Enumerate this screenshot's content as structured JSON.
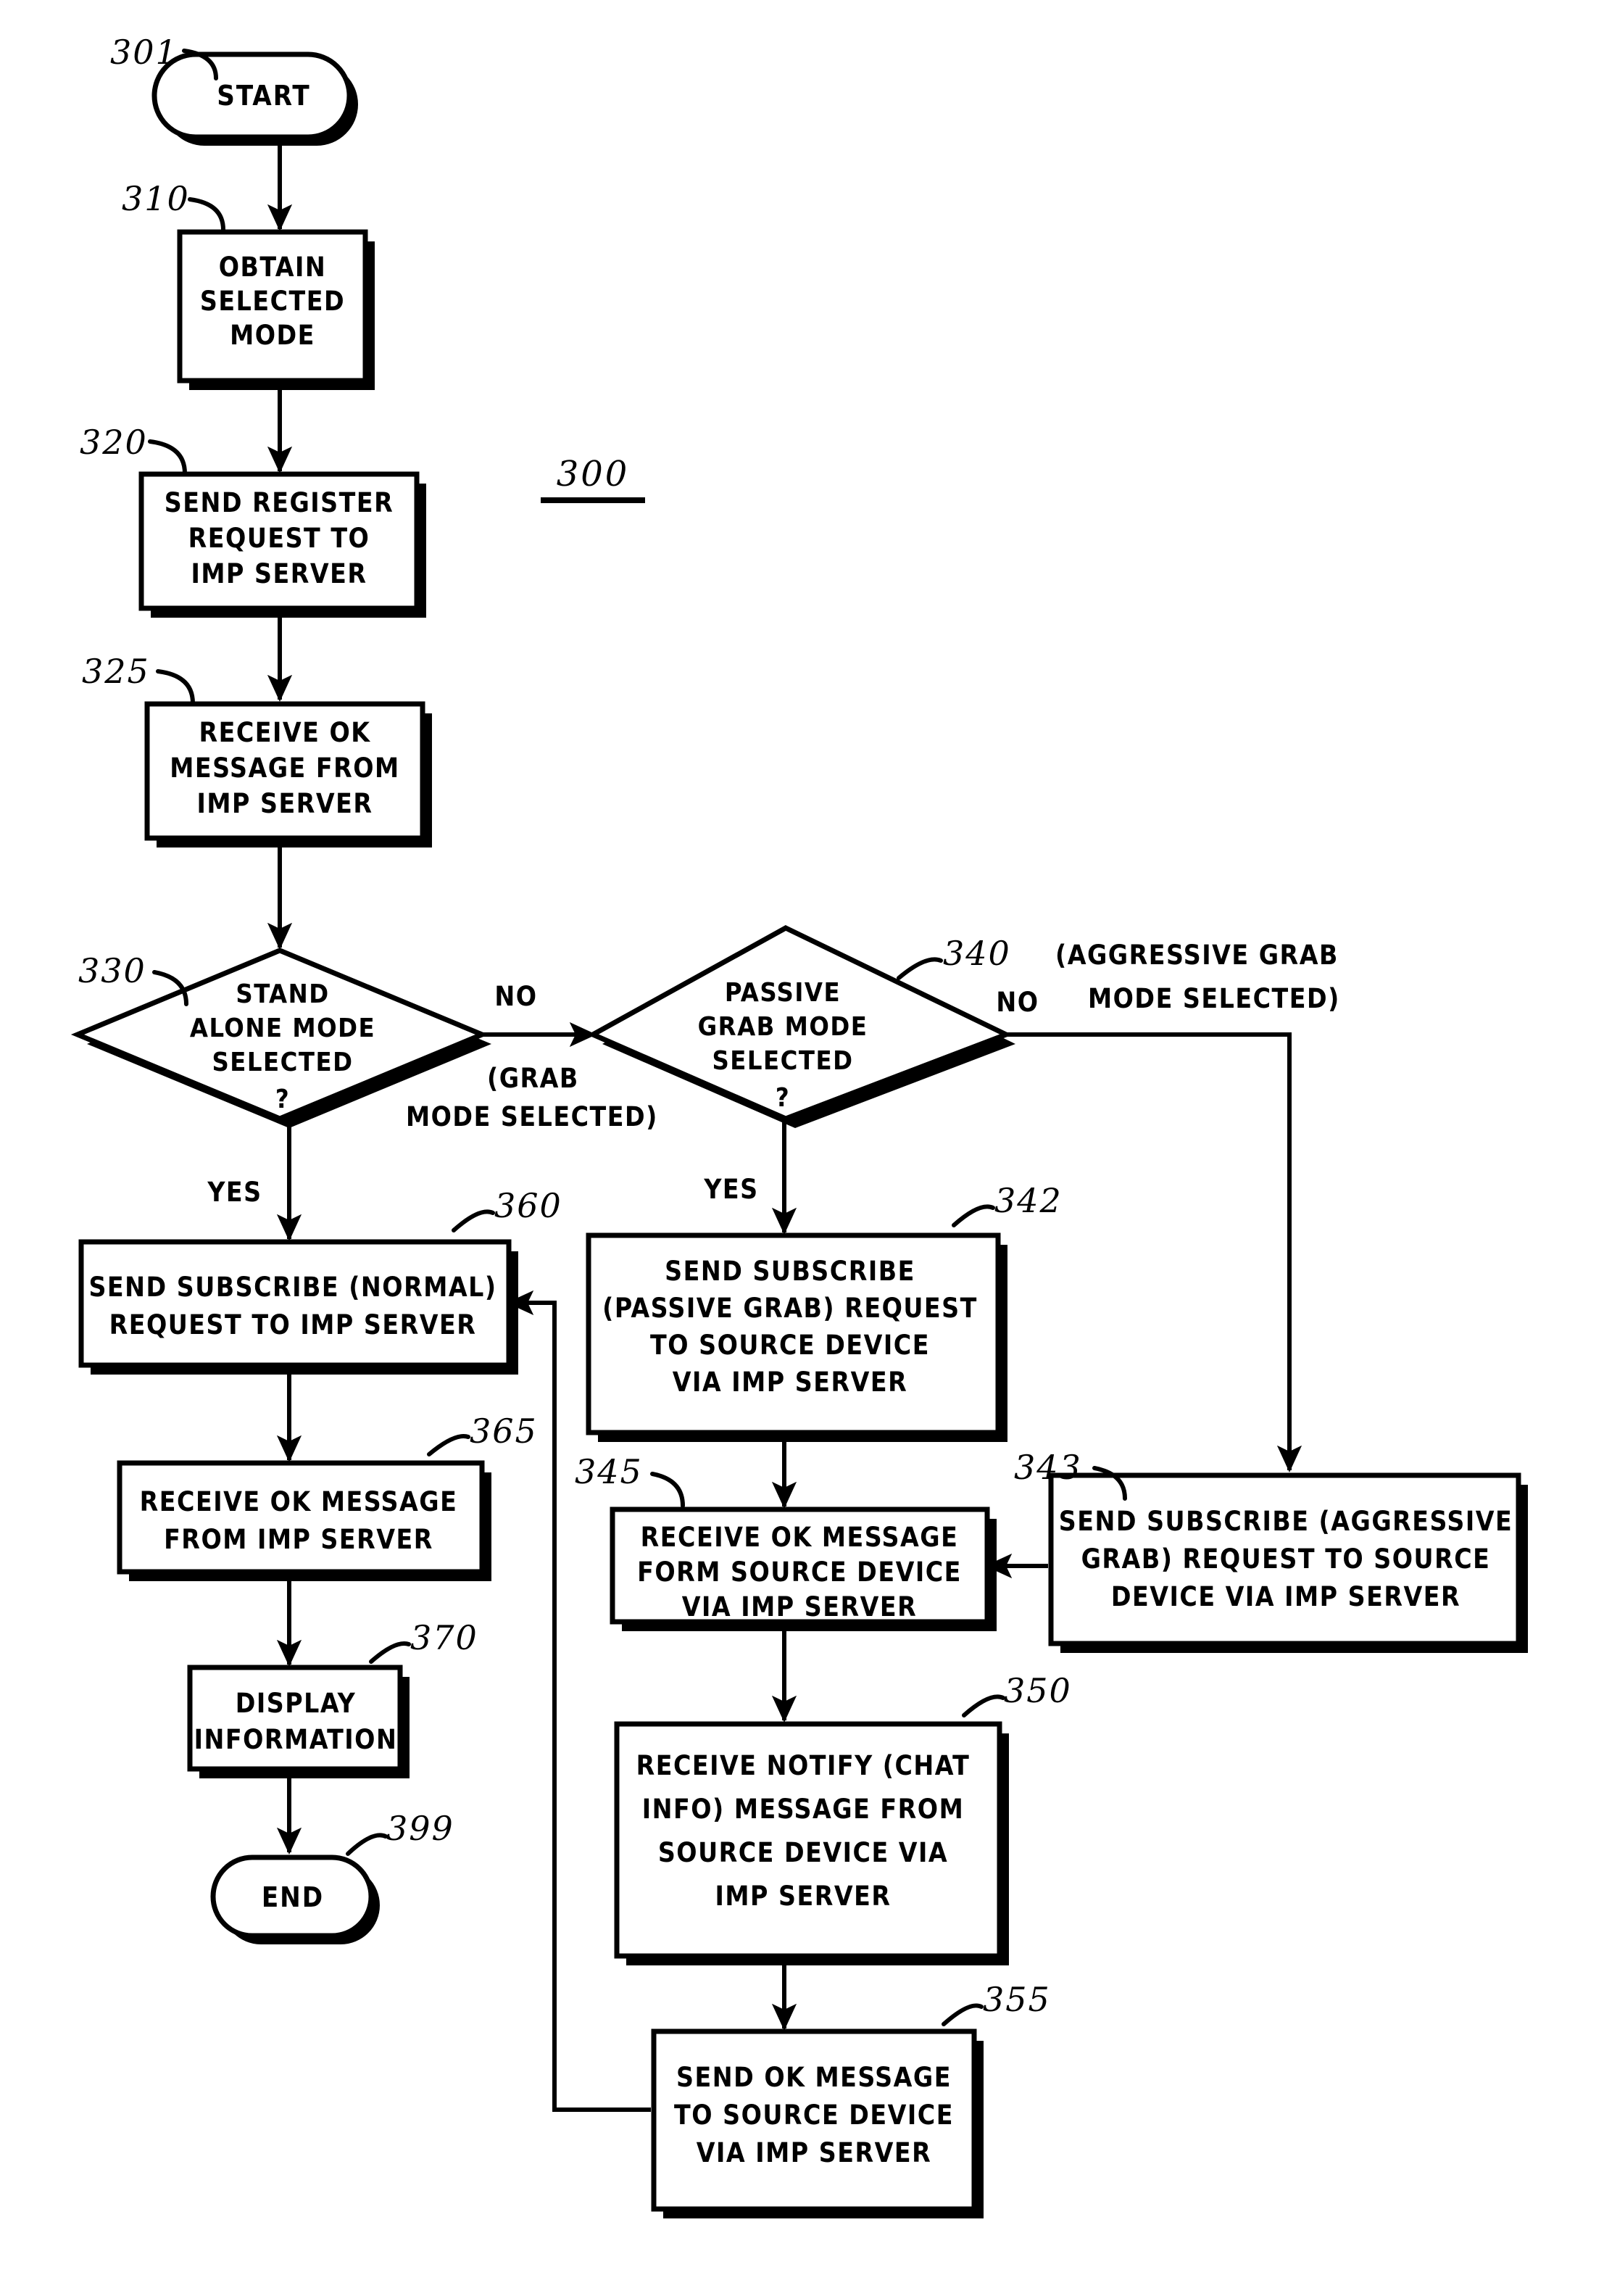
{
  "figure": {
    "number": "300",
    "title_visible": false
  },
  "nodes": [
    {
      "id": "301",
      "ref": "301",
      "type": "terminator",
      "lines": [
        "START"
      ]
    },
    {
      "id": "310",
      "ref": "310",
      "type": "process",
      "lines": [
        "OBTAIN",
        "SELECTED",
        "MODE"
      ]
    },
    {
      "id": "320",
      "ref": "320",
      "type": "process",
      "lines": [
        "SEND REGISTER",
        "REQUEST TO",
        "IMP SERVER"
      ]
    },
    {
      "id": "325",
      "ref": "325",
      "type": "process",
      "lines": [
        "RECEIVE OK",
        "MESSAGE FROM",
        "IMP SERVER"
      ]
    },
    {
      "id": "330",
      "ref": "330",
      "type": "decision",
      "lines": [
        "STAND",
        "ALONE MODE",
        "SELECTED",
        "?"
      ]
    },
    {
      "id": "340",
      "ref": "340",
      "type": "decision",
      "lines": [
        "PASSIVE",
        "GRAB MODE",
        "SELECTED",
        "?"
      ]
    },
    {
      "id": "360",
      "ref": "360",
      "type": "process",
      "lines": [
        "SEND SUBSCRIBE (NORMAL)",
        "REQUEST TO IMP SERVER"
      ]
    },
    {
      "id": "365",
      "ref": "365",
      "type": "process",
      "lines": [
        "RECEIVE OK MESSAGE",
        "FROM IMP SERVER"
      ]
    },
    {
      "id": "370",
      "ref": "370",
      "type": "process",
      "lines": [
        "DISPLAY",
        "INFORMATION"
      ]
    },
    {
      "id": "399",
      "ref": "399",
      "type": "terminator",
      "lines": [
        "END"
      ]
    },
    {
      "id": "342",
      "ref": "342",
      "type": "process",
      "lines": [
        "SEND SUBSCRIBE",
        "(PASSIVE GRAB) REQUEST",
        "TO SOURCE DEVICE",
        "VIA IMP SERVER"
      ]
    },
    {
      "id": "345",
      "ref": "345",
      "type": "process",
      "lines": [
        "RECEIVE OK MESSAGE",
        "FORM SOURCE DEVICE",
        "VIA IMP SERVER"
      ]
    },
    {
      "id": "350",
      "ref": "350",
      "type": "process",
      "lines": [
        "RECEIVE NOTIFY (CHAT",
        "INFO) MESSAGE FROM",
        "SOURCE DEVICE VIA",
        "IMP SERVER"
      ]
    },
    {
      "id": "355",
      "ref": "355",
      "type": "process",
      "lines": [
        "SEND OK MESSAGE",
        "TO SOURCE DEVICE",
        "VIA IMP SERVER"
      ]
    },
    {
      "id": "343",
      "ref": "343",
      "type": "process",
      "lines": [
        "SEND SUBSCRIBE (AGGRESSIVE",
        "GRAB) REQUEST TO SOURCE",
        "DEVICE VIA IMP SERVER"
      ]
    }
  ],
  "edge_labels": {
    "d330_no": "NO",
    "d330_yes": "YES",
    "d330_no_note_line1": "(GRAB",
    "d330_no_note_line2": "MODE SELECTED)",
    "d340_no": "NO",
    "d340_yes": "YES",
    "d340_no_note_line1": "(AGGRESSIVE GRAB",
    "d340_no_note_line2": "MODE SELECTED)"
  },
  "colors": {
    "ink": "#000000",
    "paper": "#ffffff"
  }
}
